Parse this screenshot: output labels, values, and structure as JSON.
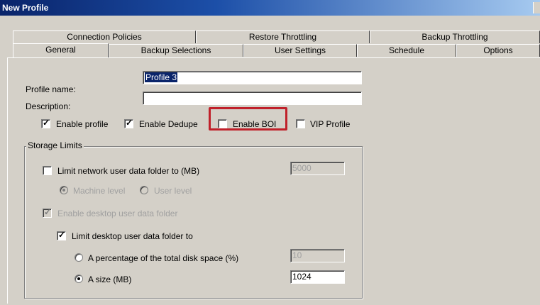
{
  "window": {
    "title": "New Profile"
  },
  "tabs": {
    "back_row": [
      "Connection Policies",
      "Restore Throttling",
      "Backup Throttling"
    ],
    "front_row": [
      "General",
      "Backup Selections",
      "User Settings",
      "Schedule",
      "Options"
    ],
    "active": "General"
  },
  "general": {
    "profile_name_label": "Profile name:",
    "profile_name_value": "Profile 3",
    "description_label": "Description:",
    "description_value": "",
    "enable_profile": {
      "label": "Enable profile",
      "checked": true
    },
    "enable_dedupe": {
      "label": "Enable Dedupe",
      "checked": true
    },
    "enable_boi": {
      "label": "Enable BOI",
      "checked": false,
      "highlight_color": "#c0202a"
    },
    "vip_profile": {
      "label": "VIP Profile",
      "checked": false
    }
  },
  "storage_limits": {
    "title": "Storage Limits",
    "limit_network": {
      "label": "Limit network user data folder to (MB)",
      "checked": false,
      "value": "5000"
    },
    "machine_level": {
      "label": "Machine level",
      "selected": true
    },
    "user_level": {
      "label": "User level",
      "selected": false
    },
    "enable_desktop": {
      "label": "Enable desktop user data folder",
      "checked": true
    },
    "limit_desktop": {
      "label": "Limit desktop user data folder to",
      "checked": true
    },
    "percentage": {
      "label": "A percentage of the total disk space (%)",
      "selected": false,
      "value": "10"
    },
    "size": {
      "label": "A size (MB)",
      "selected": true,
      "value": "1024"
    }
  }
}
